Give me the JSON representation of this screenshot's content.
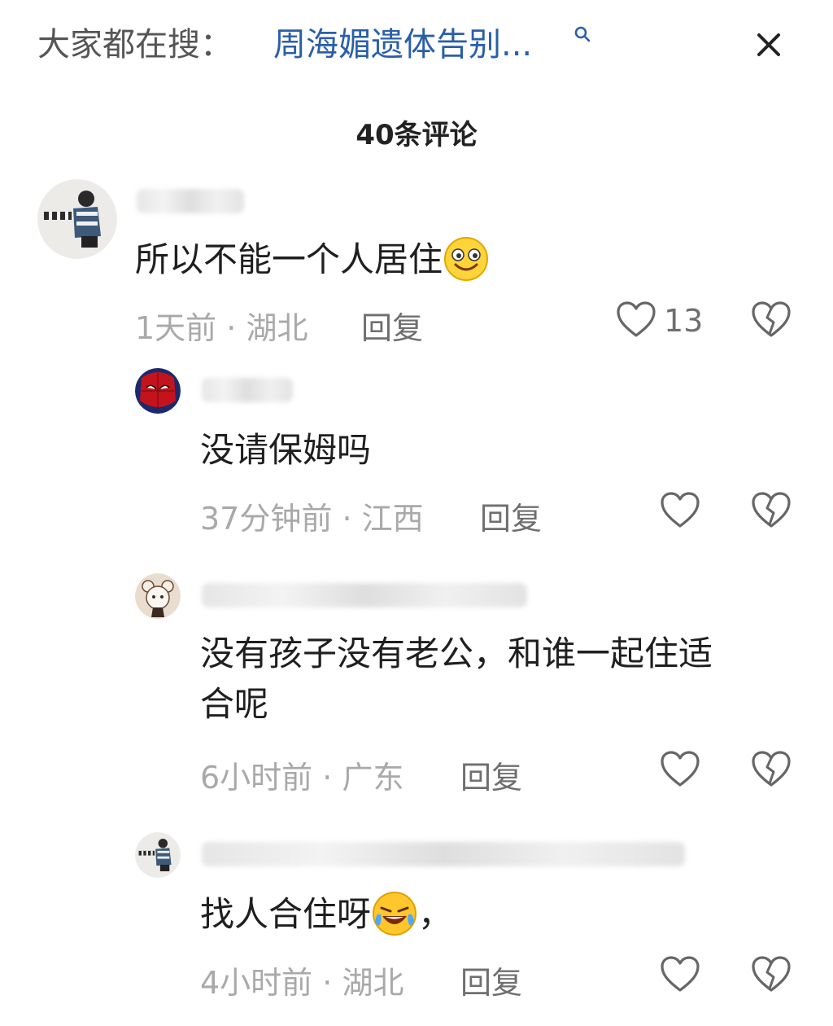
{
  "header": {
    "search_prefix": "大家都在搜：",
    "search_term": "周海媚遗体告别...",
    "comments_title": "40条评论"
  },
  "comments": [
    {
      "text": "所以不能一个人居住",
      "emoji": "smiling-face-emoji",
      "time": "1天前",
      "location": "湖北",
      "reply_label": "回复",
      "likes": "13"
    },
    {
      "text": "没请保姆吗",
      "time": "37分钟前",
      "location": "江西",
      "reply_label": "回复"
    },
    {
      "text_line1": "没有孩子没有老公，和谁一起住适",
      "text_line2": "合呢",
      "time": "6小时前",
      "location": "广东",
      "reply_label": "回复"
    },
    {
      "text": "找人合住呀",
      "text_suffix": "，",
      "emoji": "rofl-emoji",
      "time": "4小时前",
      "location": "湖北",
      "reply_label": "回复"
    }
  ],
  "colors": {
    "link_blue": "#2a5fa8",
    "meta_gray": "#a9a9a9",
    "icon_gray": "#666666"
  }
}
